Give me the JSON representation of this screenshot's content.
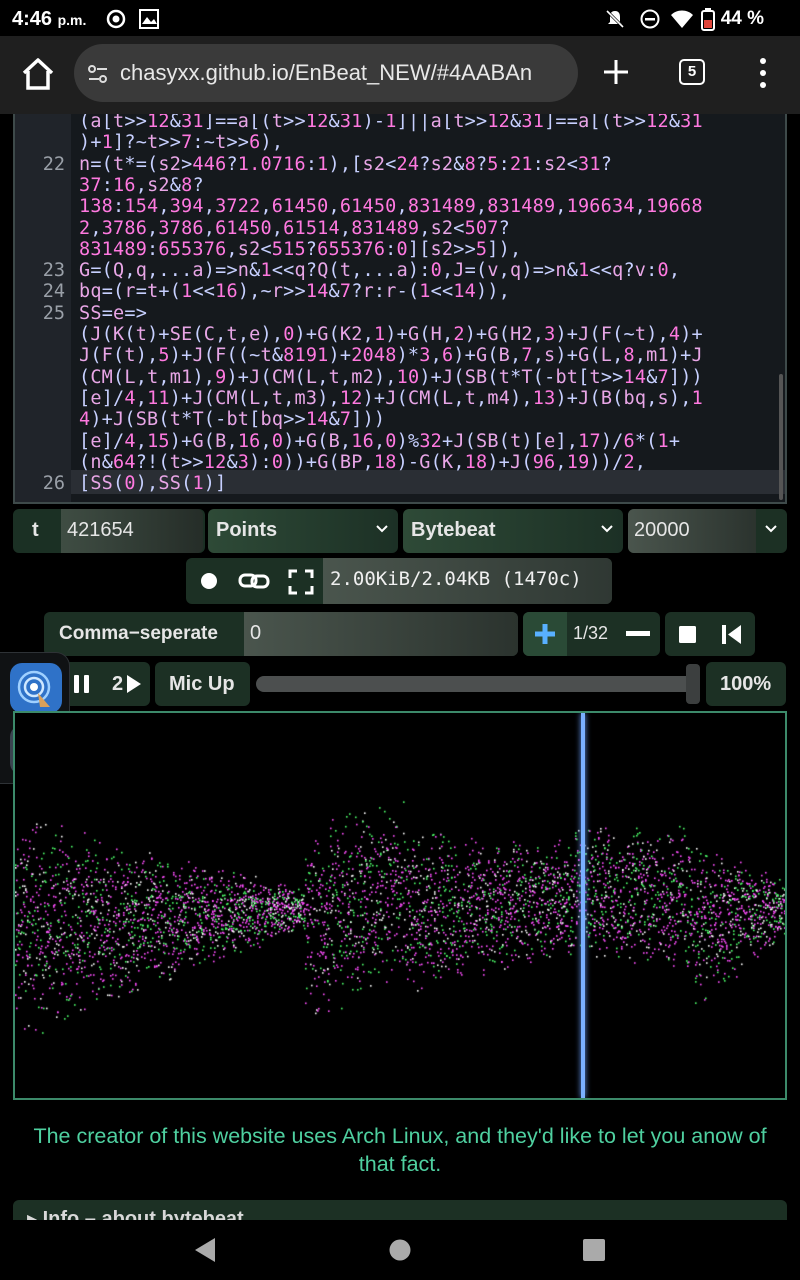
{
  "status_bar": {
    "time": "4:46",
    "ampm": "p.m.",
    "battery": "44 %"
  },
  "browser": {
    "url": "chasyxx.github.io/EnBeat_NEW/#4AABAn",
    "tab_count": "5"
  },
  "editor": {
    "lines": [
      {
        "num": "",
        "text": "(a[t>>12&31]==a[(t>>12&31)-1]||a[t>>12&31]==a[(t>>12&31"
      },
      {
        "num": "",
        "text": ")+1]?~t>>7:~t>>6),"
      },
      {
        "num": "22",
        "text": "n=(t*=(s2>446?1.0716:1),[s2<24?s2&8?5:21:s2<31?"
      },
      {
        "num": "",
        "text": "37:16,s2&8?"
      },
      {
        "num": "",
        "text": "138:154,394,3722,61450,61450,831489,831489,196634,19668"
      },
      {
        "num": "",
        "text": "2,3786,3786,61450,61514,831489,s2<507?"
      },
      {
        "num": "",
        "text": "831489:655376,s2<515?655376:0][s2>>5]),"
      },
      {
        "num": "23",
        "text": "G=(Q,q,...a)=>n&1<<q?Q(t,...a):0,J=(v,q)=>n&1<<q?v:0,"
      },
      {
        "num": "24",
        "text": "bq=(r=t+(1<<16),~r>>14&7?r:r-(1<<14)),"
      },
      {
        "num": "25",
        "text": "SS=e=>"
      },
      {
        "num": "",
        "text": "(J(K(t)+SE(C,t,e),0)+G(K2,1)+G(H,2)+G(H2,3)+J(F(~t),4)+"
      },
      {
        "num": "",
        "text": "J(F(t),5)+J(F((~t&8191)+2048)*3,6)+G(B,7,s)+G(L,8,m1)+J"
      },
      {
        "num": "",
        "text": "(CM(L,t,m1),9)+J(CM(L,t,m2),10)+J(SB(t*T(-bt[t>>14&7]))"
      },
      {
        "num": "",
        "text": "[e]/4,11)+J(CM(L,t,m3),12)+J(CM(L,t,m4),13)+J(B(bq,s),1"
      },
      {
        "num": "",
        "text": "4)+J(SB(t*T(-bt[bq>>14&7]))"
      },
      {
        "num": "",
        "text": "[e]/4,15)+G(B,16,0)+G(B,16,0)%32+J(SB(t)[e],17)/6*(1+"
      },
      {
        "num": "",
        "text": "(n&64?!(t>>12&3):0))+G(BP,18)-G(K,18)+J(96,19))/2,"
      },
      {
        "num": "26",
        "text": "[SS(0),SS(1)]"
      }
    ]
  },
  "controls": {
    "t_label": "t",
    "t_value": "421654",
    "draw_mode": "Points",
    "mode": "Bytebeat",
    "sample_rate": "20000",
    "size_text": "2.00KiB/2.04KB (1470c)",
    "comma_label": "Comma−seperate",
    "comma_value": "0",
    "scale": "1/32",
    "speed": "2",
    "mic_label": "Mic Up",
    "volume": "100%",
    "volume_level": 0.98
  },
  "notice": "The creator of this website uses Arch Linux, and they'd like to let you anow of that fact.",
  "info_label": "▸ Info – about bytebeat",
  "colors": {
    "accent_green": "#4fd0a0",
    "panel_green": "#1c3024",
    "viz_border": "#3c8a6a",
    "wave_magenta": "#ff4dff",
    "wave_green": "#4dff6a",
    "cursor_blue": "#7ab0ff"
  }
}
